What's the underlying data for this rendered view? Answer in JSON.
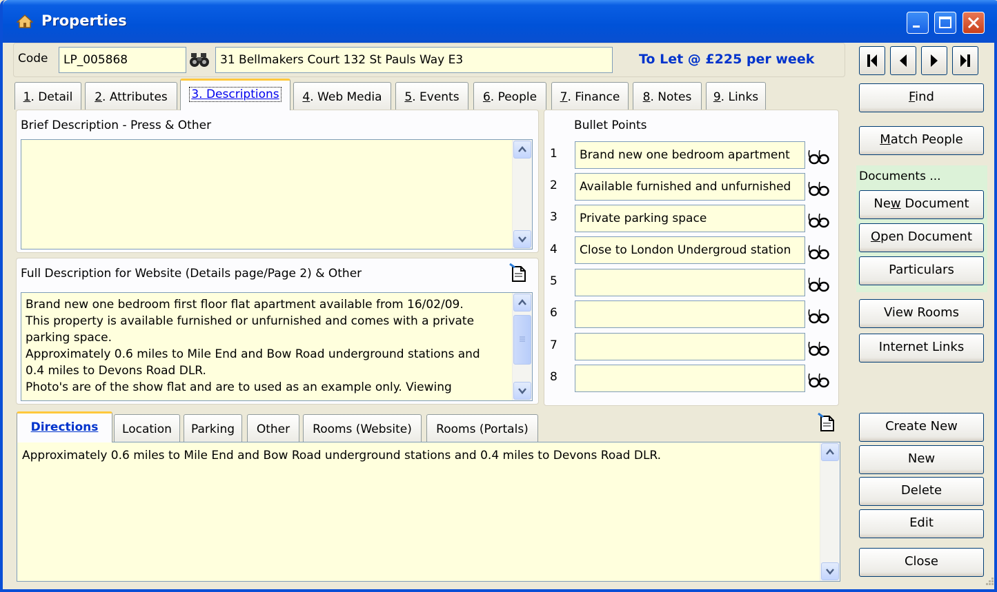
{
  "window": {
    "title": "Properties"
  },
  "header": {
    "code_label": "Code",
    "code_value": "LP_005868",
    "address_value": "31 Bellmakers Court 132 St Pauls Way E3",
    "status_text": "To Let @ £225 per week"
  },
  "tabs": [
    {
      "num": "1",
      "label": ". Detail"
    },
    {
      "num": "2",
      "label": ". Attributes"
    },
    {
      "num": "3",
      "label": ". Descriptions"
    },
    {
      "num": "4",
      "label": ". Web Media"
    },
    {
      "num": "5",
      "label": ". Events"
    },
    {
      "num": "6",
      "label": ". People"
    },
    {
      "num": "7",
      "label": ". Finance"
    },
    {
      "num": "8",
      "label": ". Notes"
    },
    {
      "num": "9",
      "label": ". Links"
    }
  ],
  "active_tab_full": "3. Descriptions",
  "brief": {
    "label": "Brief Description - Press & Other",
    "text": ""
  },
  "full": {
    "label": "Full Description for Website (Details page/Page 2) & Other",
    "line1": "Brand new one bedroom first floor flat apartment available from 16/02/09.",
    "line2": "This property is available furnished or unfurnished and comes with a private",
    "line3": "parking space.",
    "line4": "Approximately 0.6 miles to Mile End and Bow Road underground stations and",
    "line5": "0.4 miles to Devons Road DLR.",
    "line6": "Photo's are of the show flat and are to used as an example only. Viewing"
  },
  "bullets": {
    "label": "Bullet Points",
    "items": [
      {
        "num": "1",
        "value": "Brand new one bedroom apartment"
      },
      {
        "num": "2",
        "value": "Available furnished and unfurnished"
      },
      {
        "num": "3",
        "value": "Private parking space"
      },
      {
        "num": "4",
        "value": "Close to London Undergroud station"
      },
      {
        "num": "5",
        "value": ""
      },
      {
        "num": "6",
        "value": ""
      },
      {
        "num": "7",
        "value": ""
      },
      {
        "num": "8",
        "value": ""
      }
    ]
  },
  "subtabs": [
    "Directions",
    "Location",
    "Parking",
    "Other",
    "Rooms (Website)",
    "Rooms (Portals)"
  ],
  "directions_text": "Approximately 0.6 miles to Mile End and Bow Road underground stations and 0.4 miles to Devons Road DLR.",
  "sidebar": {
    "find": {
      "pre": "",
      "key": "F",
      "post": "ind"
    },
    "match_people": {
      "pre": "",
      "key": "M",
      "post": "atch People"
    },
    "documents_label": "Documents ...",
    "new_document": {
      "pre": "Ne",
      "key": "w",
      "post": " Document"
    },
    "open_document": {
      "pre": "",
      "key": "O",
      "post": "pen Document"
    },
    "particulars": "Particulars",
    "view_rooms": "View Rooms",
    "internet_links": "Internet Links",
    "create_new": "Create New",
    "new": "New",
    "delete": "Delete",
    "edit": "Edit",
    "close": "Close"
  },
  "colors": {
    "field_bg": "#ffffdd",
    "title_blue": "#0a5ee3",
    "status_blue": "#0033cc",
    "window_bg": "#ece9d8"
  }
}
